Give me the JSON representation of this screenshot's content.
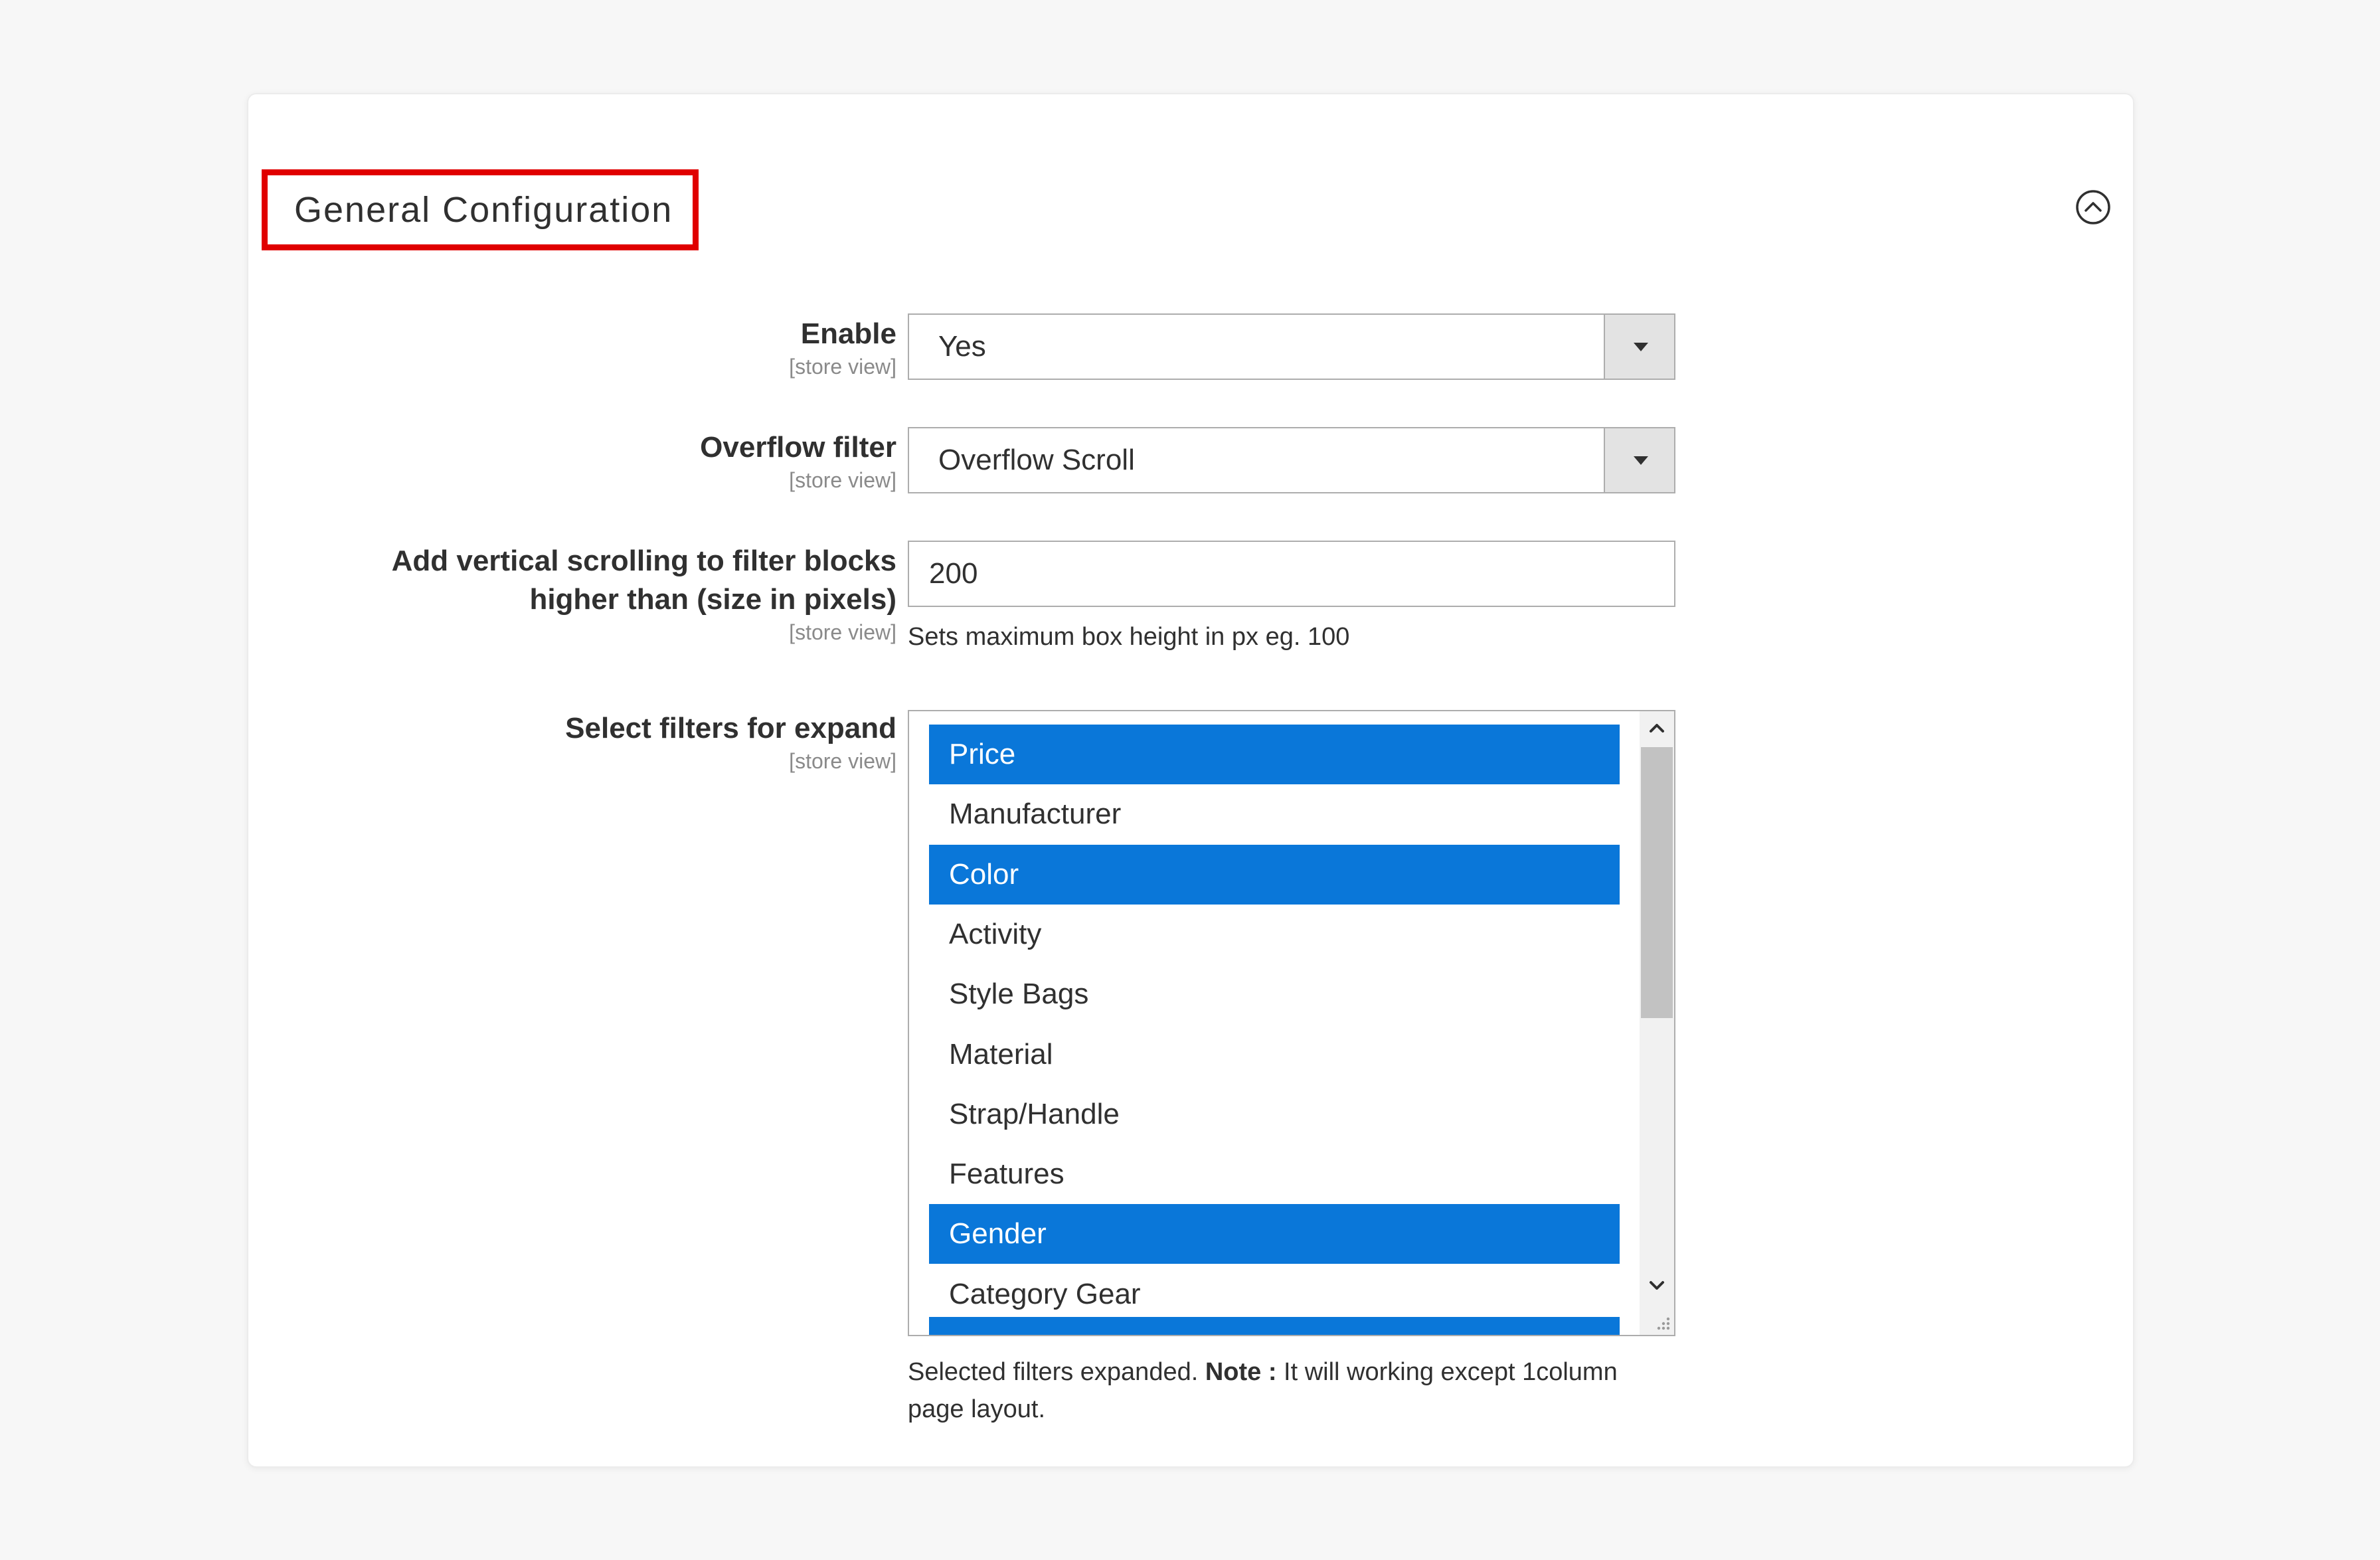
{
  "section": {
    "title": "General Configuration"
  },
  "fields": {
    "enable": {
      "label": "Enable",
      "scope": "[store view]",
      "value": "Yes"
    },
    "overflow": {
      "label": "Overflow filter",
      "scope": "[store view]",
      "value": "Overflow Scroll"
    },
    "scroll_height": {
      "label_line1": "Add vertical scrolling to filter blocks",
      "label_line2": "higher than (size in pixels)",
      "scope": "[store view]",
      "value": "200",
      "hint": "Sets maximum box height in px eg. 100"
    },
    "expand": {
      "label": "Select filters for expand",
      "scope": "[store view]",
      "options": [
        {
          "label": "Price",
          "selected": true
        },
        {
          "label": "Manufacturer",
          "selected": false
        },
        {
          "label": "Color",
          "selected": true
        },
        {
          "label": "Activity",
          "selected": false
        },
        {
          "label": "Style Bags",
          "selected": false
        },
        {
          "label": "Material",
          "selected": false
        },
        {
          "label": "Strap/Handle",
          "selected": false
        },
        {
          "label": "Features",
          "selected": false
        },
        {
          "label": "Gender",
          "selected": true
        },
        {
          "label": "Category Gear",
          "selected": false
        }
      ],
      "note_prefix": "Selected filters expanded. ",
      "note_bold": "Note :",
      "note_suffix": " It will working except 1column",
      "note_line2": "page layout."
    }
  },
  "colors": {
    "selected_option": "#0a77d9",
    "highlight_border": "#e00000"
  },
  "icons": {
    "collapse": "chevron-up-circle-icon",
    "dropdown": "triangle-down-icon"
  }
}
